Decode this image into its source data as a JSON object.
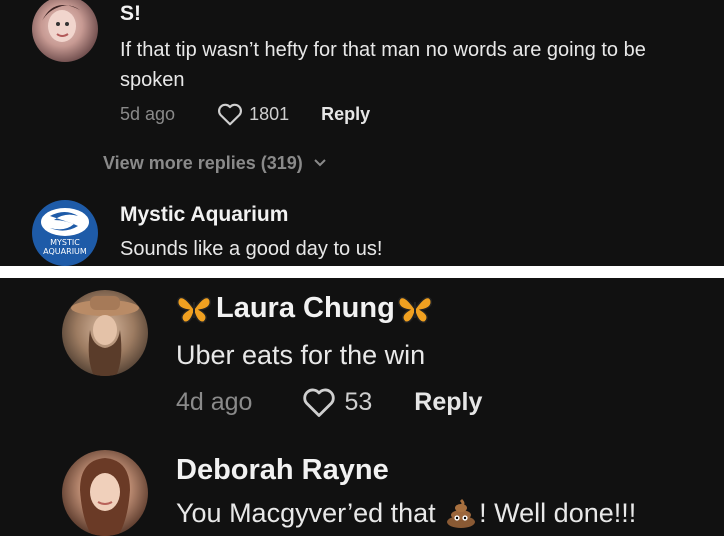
{
  "top": {
    "comment1": {
      "name": "S!",
      "text": "If that tip wasn’t hefty for that man no words are going to be spoken",
      "age": "5d ago",
      "likes": "1801",
      "reply_label": "Reply"
    },
    "view_more": "View more replies (319)",
    "comment2": {
      "name": "Mystic Aquarium",
      "text": "Sounds like a good day to us!",
      "logo_text_1": "MYSTIC",
      "logo_text_2": "AQUARIUM"
    }
  },
  "bottom": {
    "comment1": {
      "name": "Laura Chung",
      "name_emoji": "butterfly-icon",
      "text": "Uber eats for the win",
      "age": "4d ago",
      "likes": "53",
      "reply_label": "Reply"
    },
    "comment2": {
      "name": "Deborah Rayne",
      "text_before": "You Macgyver’ed that ",
      "emoji": "pile-of-poo-icon",
      "text_after": "! Well done!!!"
    }
  },
  "colors": {
    "background": "#111111",
    "divider": "#ffffff",
    "meta_text": "#8a8a8a",
    "aquarium_blue": "#1e5ba8"
  }
}
